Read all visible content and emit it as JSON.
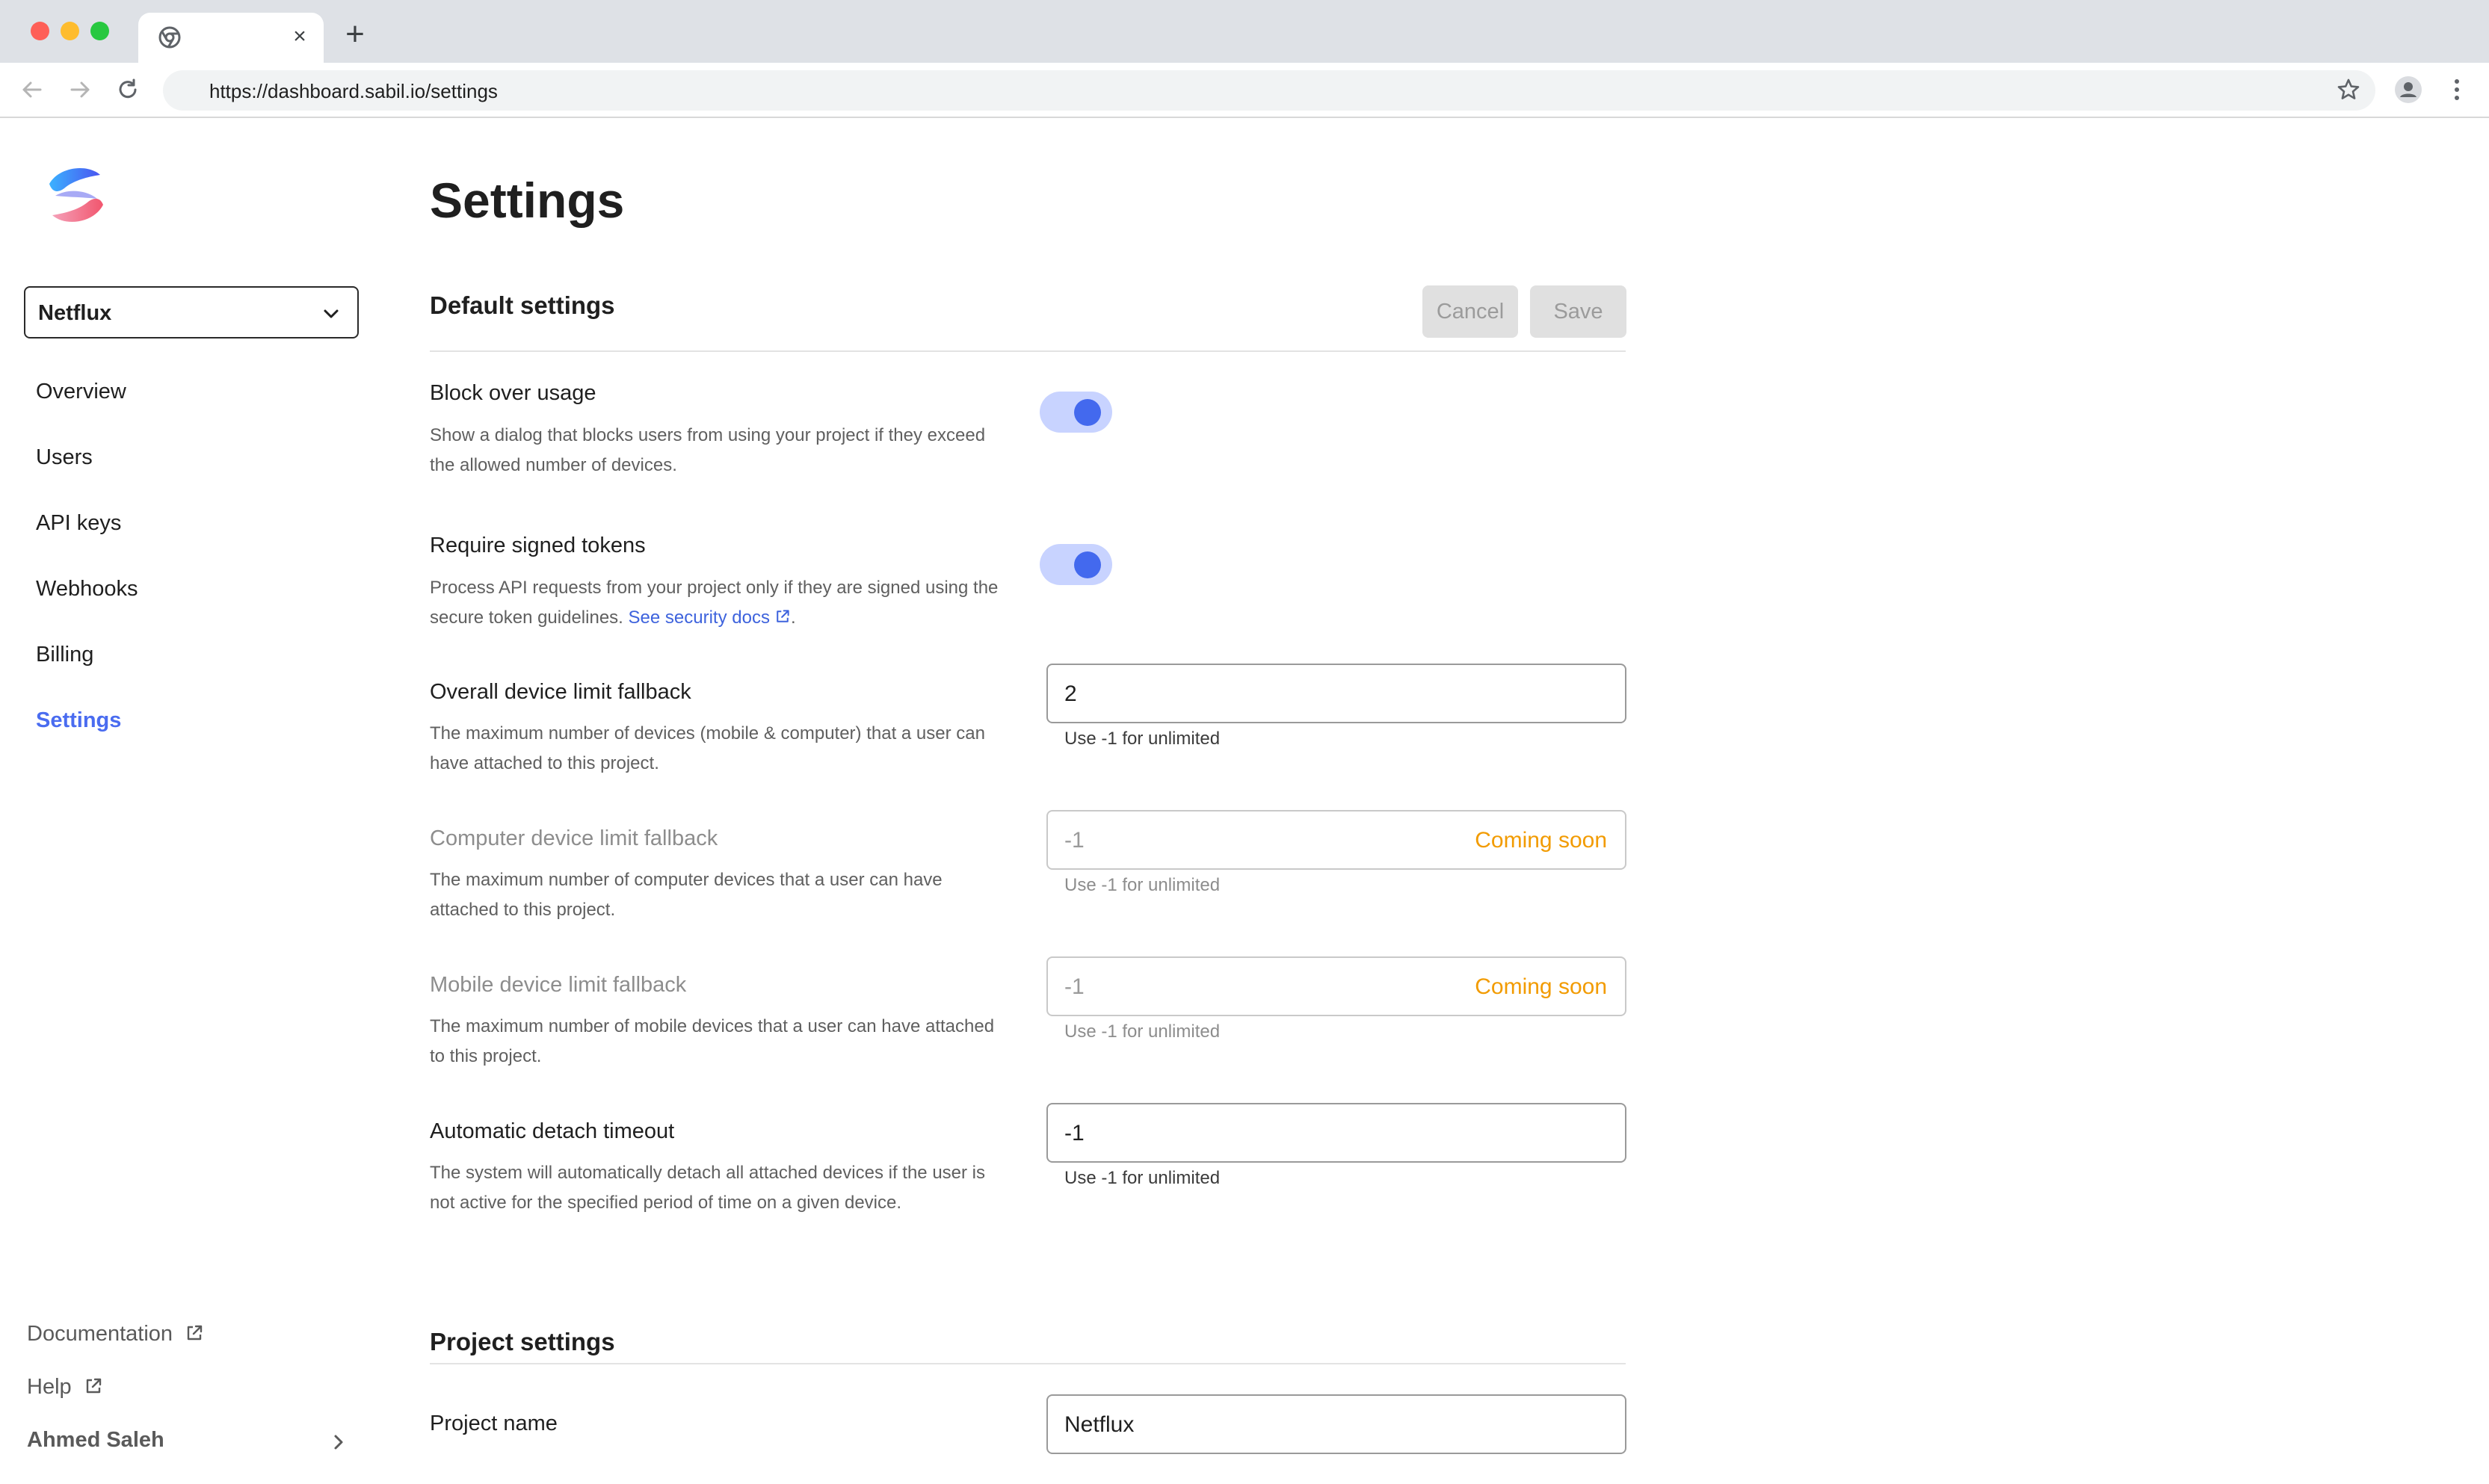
{
  "browser": {
    "url": "https://dashboard.sabil.io/settings",
    "tab_close_glyph": "×",
    "new_tab_glyph": "+"
  },
  "sidebar": {
    "project_selector": "Netflux",
    "nav": [
      {
        "label": "Overview",
        "active": false
      },
      {
        "label": "Users",
        "active": false
      },
      {
        "label": "API keys",
        "active": false
      },
      {
        "label": "Webhooks",
        "active": false
      },
      {
        "label": "Billing",
        "active": false
      },
      {
        "label": "Settings",
        "active": true
      }
    ],
    "footer": {
      "documentation": "Documentation",
      "help": "Help",
      "user_name": "Ahmed Saleh"
    }
  },
  "main": {
    "page_title": "Settings",
    "default_settings": {
      "title": "Default settings",
      "cancel_label": "Cancel",
      "save_label": "Save",
      "block_over_usage": {
        "label": "Block over usage",
        "description": "Show a dialog that blocks users from using your project if they exceed the allowed number of devices.",
        "enabled": true
      },
      "require_signed_tokens": {
        "label": "Require signed tokens",
        "description": "Process API requests from your project only if they are signed using the secure token guidelines.",
        "link_text": "See security docs",
        "trailing": ".",
        "enabled": true
      },
      "overall_device_limit": {
        "label": "Overall device limit fallback",
        "description": "The maximum number of devices (mobile & computer) that a user can have attached to this project.",
        "value": "2",
        "help": "Use -1 for unlimited"
      },
      "computer_device_limit": {
        "label": "Computer device limit fallback",
        "description": "The maximum number of computer devices that a user can have attached to this project.",
        "value": "-1",
        "badge": "Coming soon",
        "help": "Use -1 for unlimited"
      },
      "mobile_device_limit": {
        "label": "Mobile device limit fallback",
        "description": "The maximum number of mobile devices that a user can have attached to this project.",
        "value": "-1",
        "badge": "Coming soon",
        "help": "Use -1 for unlimited"
      },
      "automatic_detach_timeout": {
        "label": "Automatic detach timeout",
        "description": "The system will automatically detach all attached devices if the user is not active for the specified period of time on a given device.",
        "value": "-1",
        "help": "Use -1 for unlimited"
      }
    },
    "project_settings": {
      "title": "Project settings",
      "project_name_label": "Project name",
      "project_name_value": "Netflux"
    }
  },
  "colors": {
    "accent": "#4a6cf0",
    "toggle_track": "#c8d3ff",
    "toggle_knob": "#4369ee",
    "coming_soon": "#f29b00",
    "link": "#3e63dd"
  }
}
